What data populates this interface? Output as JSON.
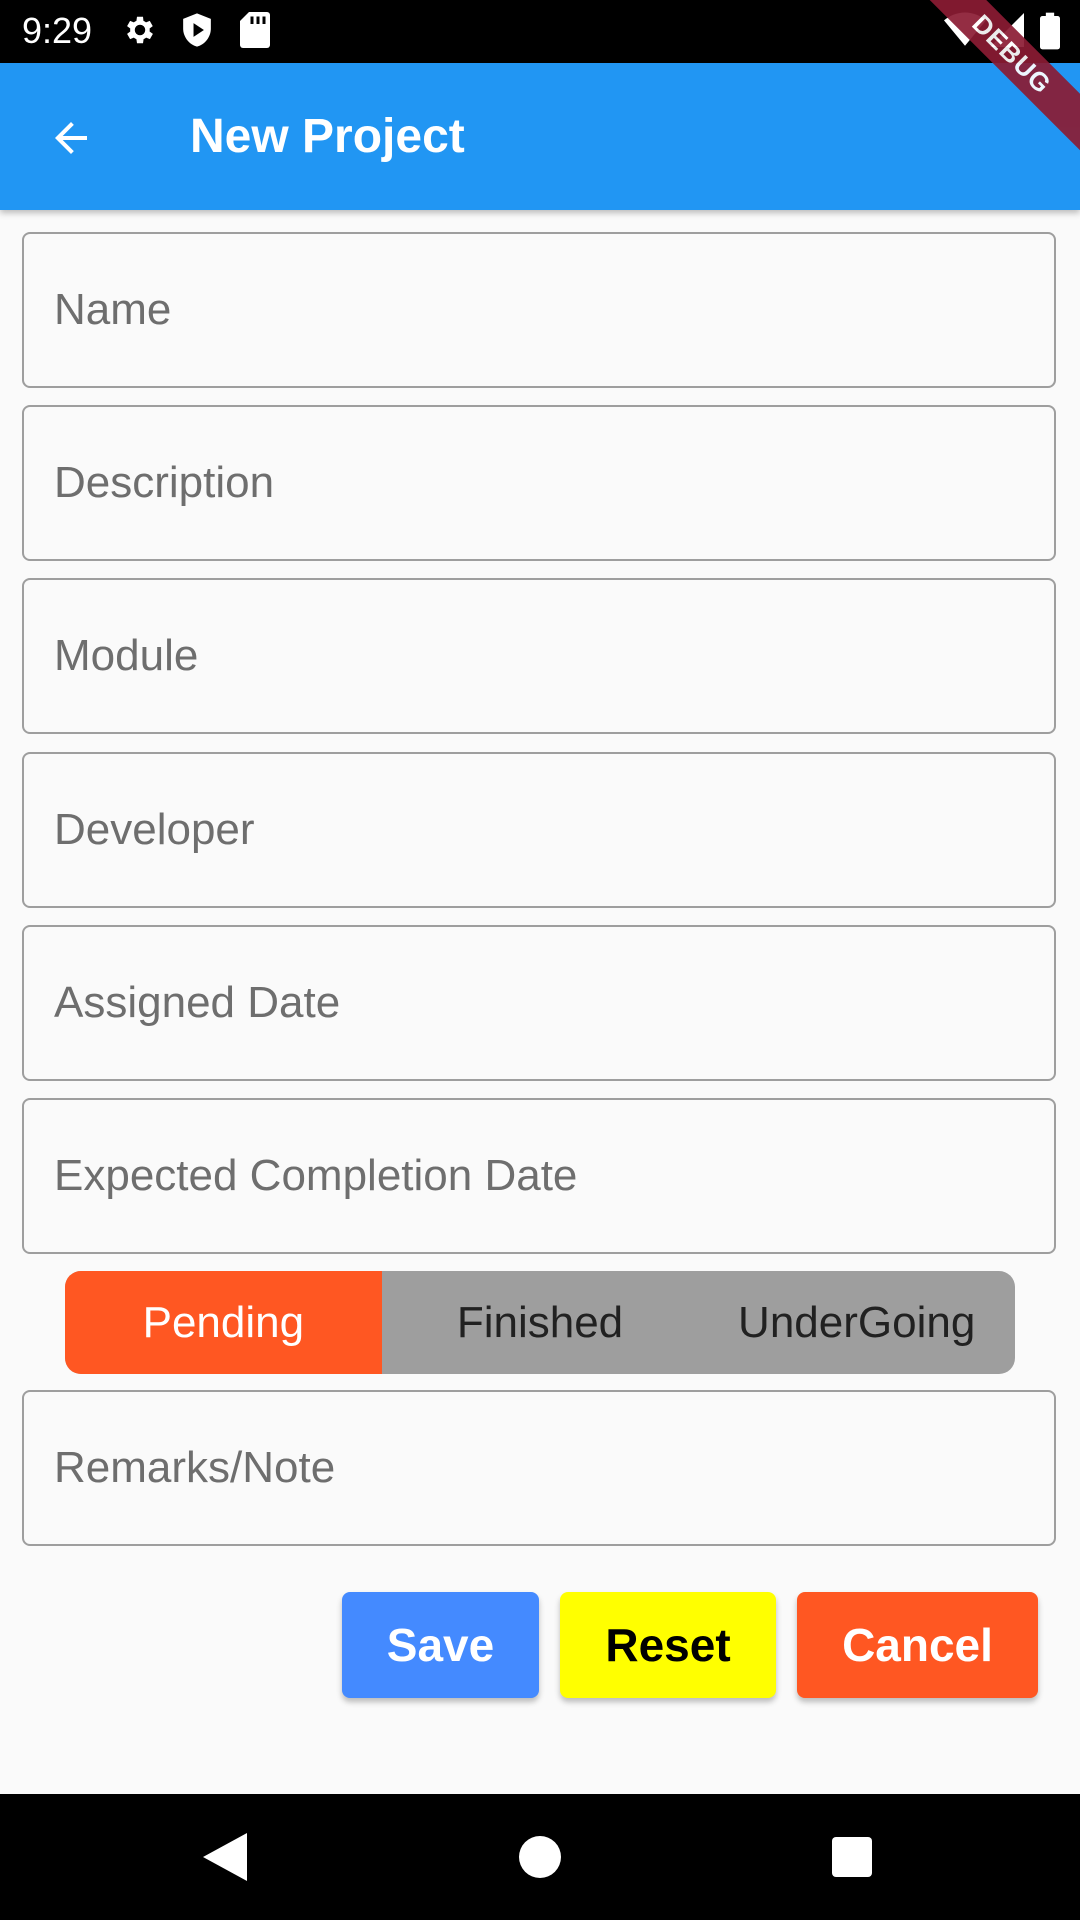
{
  "status_bar": {
    "time": "9:29",
    "icons": [
      "gear-icon",
      "play-protect-icon",
      "sd-card-icon",
      "wifi-icon",
      "signal-icon",
      "battery-icon"
    ]
  },
  "debug_banner": "DEBUG",
  "app_bar": {
    "title": "New Project",
    "back_icon": "arrow-back-icon",
    "color": "#2196f3"
  },
  "form": {
    "name": {
      "placeholder": "Name",
      "value": ""
    },
    "description": {
      "placeholder": "Description",
      "value": ""
    },
    "module": {
      "placeholder": "Module",
      "value": ""
    },
    "developer": {
      "placeholder": "Developer",
      "value": ""
    },
    "assigned_date": {
      "placeholder": "Assigned Date",
      "value": ""
    },
    "expected_completion_date": {
      "placeholder": "Expected Completion Date",
      "value": ""
    },
    "remarks": {
      "placeholder": "Remarks/Note",
      "value": ""
    }
  },
  "status_toggle": {
    "options": [
      "Pending",
      "Finished",
      "UnderGoing"
    ],
    "selected": "Pending",
    "active_color": "#ff5722",
    "inactive_color": "#9e9e9e"
  },
  "actions": {
    "save": {
      "label": "Save",
      "color": "#448aff"
    },
    "reset": {
      "label": "Reset",
      "color": "#ffff00"
    },
    "cancel": {
      "label": "Cancel",
      "color": "#ff5722"
    }
  },
  "nav_bar": {
    "icons": [
      "back-triangle-icon",
      "home-circle-icon",
      "recents-square-icon"
    ]
  }
}
